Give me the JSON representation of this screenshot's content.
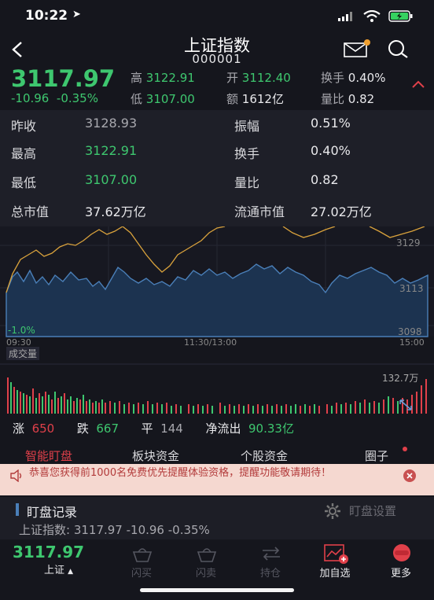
{
  "status_bar": {
    "time": "10:22"
  },
  "header": {
    "title": "上证指数",
    "code": "000001"
  },
  "quote": {
    "price": "3117.97",
    "change": "-10.96",
    "change_pct": "-0.35%",
    "high_label": "高",
    "high": "3122.91",
    "low_label": "低",
    "low": "3107.00",
    "open_label": "开",
    "open": "3112.40",
    "amount_label": "额",
    "amount": "1612亿",
    "turnover_label": "换手",
    "turnover": "0.40%",
    "vol_ratio_label": "量比",
    "vol_ratio": "0.82"
  },
  "details": [
    {
      "label": "昨收",
      "value": "3128.93",
      "label2": "振幅",
      "value2": "0.51%"
    },
    {
      "label": "最高",
      "value": "3122.91",
      "label2": "换手",
      "value2": "0.40%"
    },
    {
      "label": "最低",
      "value": "3107.00",
      "label2": "量比",
      "value2": "0.82"
    },
    {
      "label": "总市值",
      "value": "37.62万亿",
      "label2": "流通市值",
      "value2": "27.02万亿"
    }
  ],
  "chart": {
    "price_labels": [
      "3129",
      "3113",
      "3098"
    ],
    "pct_label": "-1.0%",
    "time_labels": [
      "09:30",
      "11:30/13:00",
      "15:00"
    ],
    "volume_title": "成交量",
    "volume_max": "132.7万"
  },
  "breadth": {
    "up_label": "涨",
    "up": "650",
    "down_label": "跌",
    "down": "667",
    "flat_label": "平",
    "flat": "144",
    "netflow_label": "净流出",
    "netflow": "90.33亿"
  },
  "tabs": [
    "智能盯盘",
    "板块资金",
    "个股资金",
    "圈子"
  ],
  "banner": {
    "text": "恭喜您获得前1000名免费优先提醒体验资格，提醒功能敬请期待！"
  },
  "record": {
    "title": "盯盘记录",
    "settings": "盯盘设置",
    "line": "上证指数: 3117.97  -10.96  -0.35%"
  },
  "bottom": {
    "price": "3117.97",
    "market": "上证",
    "items": [
      "闪买",
      "闪卖",
      "持仓",
      "加自选",
      "更多"
    ]
  },
  "colors": {
    "up": "#e0404a",
    "down": "#3ec76f",
    "accent": "#f0a030"
  }
}
